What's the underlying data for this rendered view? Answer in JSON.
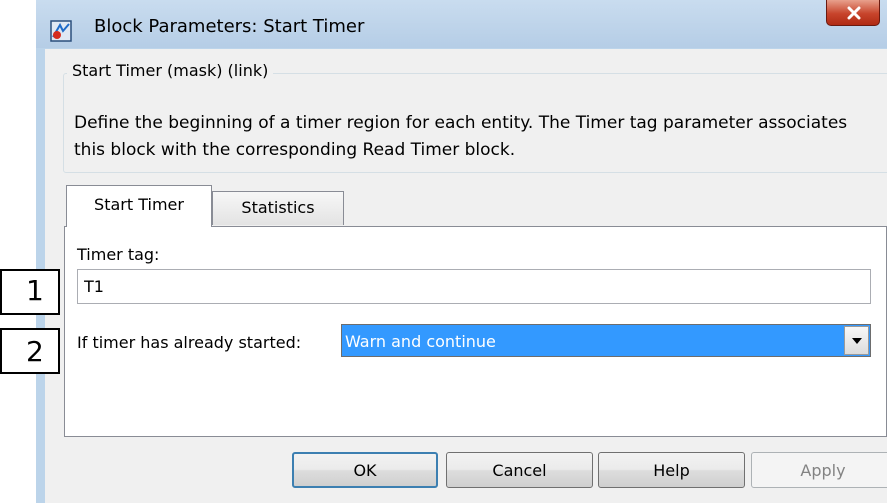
{
  "window": {
    "title": "Block Parameters: Start Timer",
    "icons": {
      "app": "simulink-block-icon",
      "close": "close-icon"
    }
  },
  "description_group": {
    "legend": "Start Timer (mask) (link)",
    "text": "Define the beginning of a timer region for each entity. The Timer tag parameter associates this block with the corresponding Read Timer block."
  },
  "tabs": [
    {
      "label": "Start Timer",
      "selected": true
    },
    {
      "label": "Statistics",
      "selected": false
    }
  ],
  "parameters": {
    "timer_tag": {
      "label": "Timer tag:",
      "value": "T1"
    },
    "already_started": {
      "label": "If timer has already started:",
      "selected": "Warn and continue"
    }
  },
  "buttons": {
    "ok": "OK",
    "cancel": "Cancel",
    "help": "Help",
    "apply": "Apply"
  },
  "callouts": [
    "1",
    "2"
  ],
  "colors": {
    "selection": "#3399ff",
    "frame": "#bcd4ea",
    "close_button": "#c7442b"
  }
}
